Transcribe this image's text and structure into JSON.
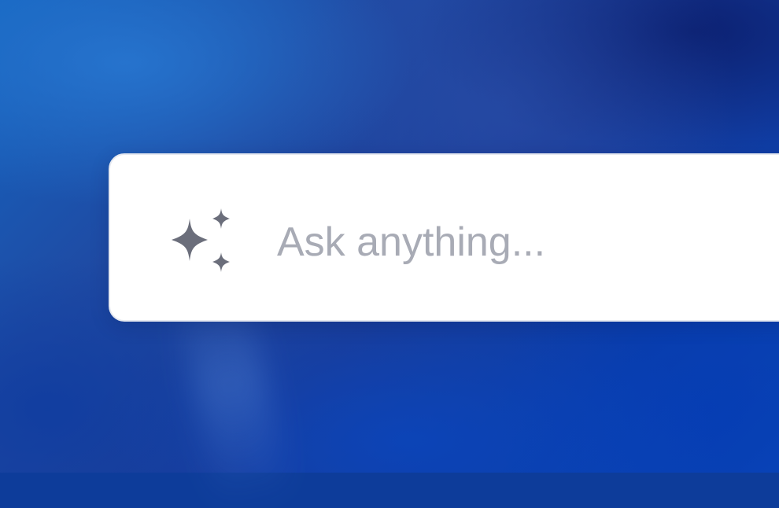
{
  "prompt": {
    "placeholder": "Ask anything...",
    "value": "",
    "icon": "sparkles-icon",
    "icon_color": "#6b6e7b",
    "placeholder_color": "#a8abb5"
  },
  "background": {
    "colors": [
      "#1565c0",
      "#1f4aa3",
      "#0b3eaa"
    ]
  }
}
